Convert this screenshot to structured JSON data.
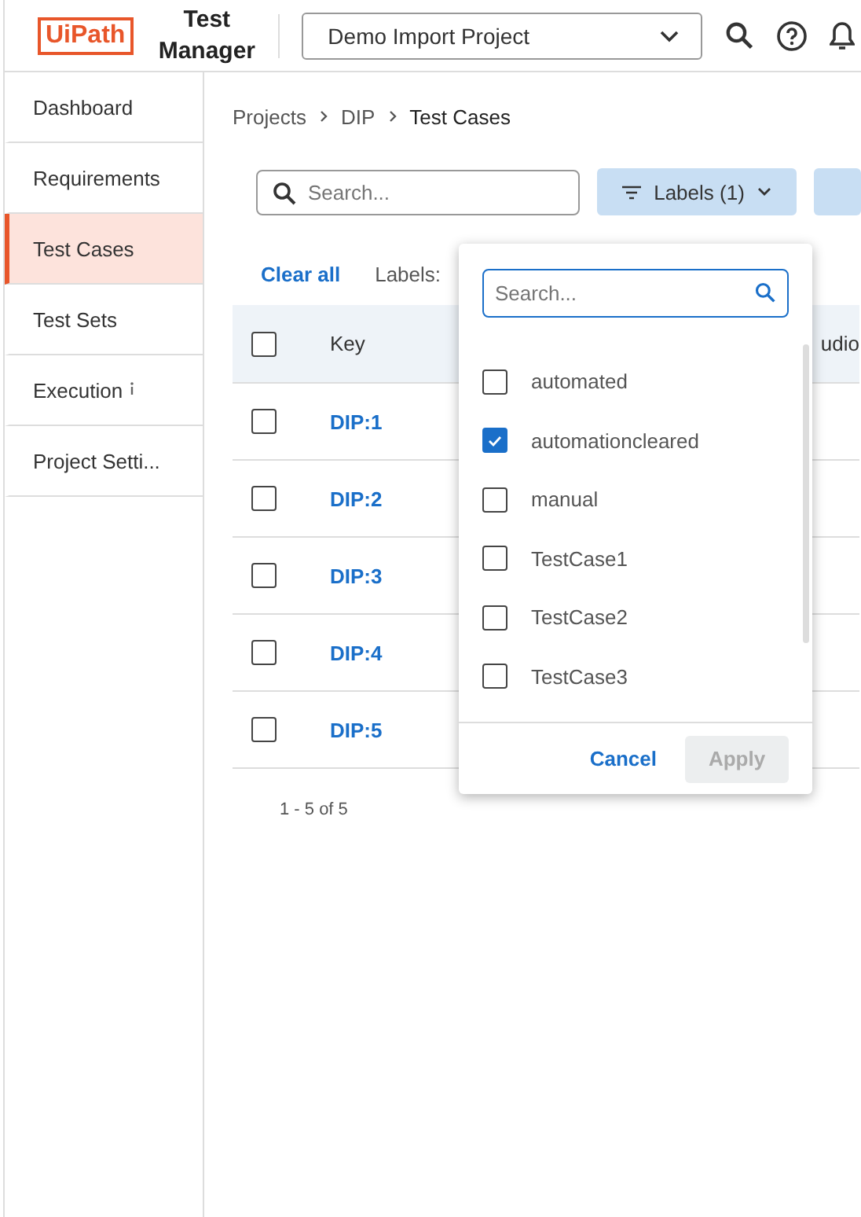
{
  "header": {
    "logo": "UiPath",
    "product": "Test Manager",
    "project": "Demo Import Project"
  },
  "sidebar": {
    "items": [
      {
        "label": "Dashboard",
        "selected": false,
        "info": false
      },
      {
        "label": "Requirements",
        "selected": false,
        "info": false
      },
      {
        "label": "Test Cases",
        "selected": true,
        "info": false
      },
      {
        "label": "Test Sets",
        "selected": false,
        "info": false
      },
      {
        "label": "Execution",
        "selected": false,
        "info": true
      },
      {
        "label": "Project Setti...",
        "selected": false,
        "info": false
      }
    ]
  },
  "breadcrumb": [
    "Projects",
    "DIP",
    "Test Cases"
  ],
  "search": {
    "placeholder": "Search..."
  },
  "labels_button": "Labels (1)",
  "clear_all": "Clear all",
  "labels_prefix": "Labels:",
  "table": {
    "columns": [
      "Key",
      "udio"
    ],
    "rows": [
      {
        "key": "DIP:1",
        "checked": false
      },
      {
        "key": "DIP:2",
        "checked": false
      },
      {
        "key": "DIP:3",
        "checked": false
      },
      {
        "key": "DIP:4",
        "checked": false
      },
      {
        "key": "DIP:5",
        "checked": false
      }
    ],
    "header_checked": false
  },
  "pagination": "1 - 5 of 5",
  "label_popup": {
    "search_placeholder": "Search...",
    "options": [
      {
        "label": "automated",
        "checked": false
      },
      {
        "label": "automationcleared",
        "checked": true
      },
      {
        "label": "manual",
        "checked": false
      },
      {
        "label": "TestCase1",
        "checked": false
      },
      {
        "label": "TestCase2",
        "checked": false
      },
      {
        "label": "TestCase3",
        "checked": false
      }
    ],
    "cancel": "Cancel",
    "apply": "Apply",
    "apply_disabled": true
  }
}
